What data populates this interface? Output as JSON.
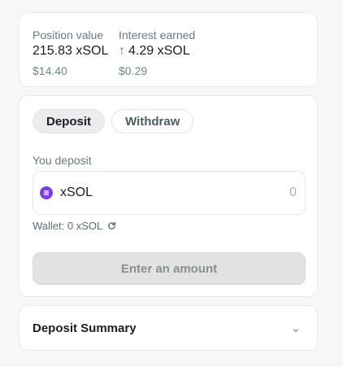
{
  "position": {
    "value_label": "Position value",
    "value_amount": "215.83 xSOL",
    "value_usd": "$14.40",
    "interest_label": "Interest earned",
    "interest_amount": "4.29 xSOL",
    "interest_usd": "$0.29",
    "interest_arrow": "↑"
  },
  "tabs": {
    "deposit": "Deposit",
    "withdraw": "Withdraw"
  },
  "deposit": {
    "label": "You deposit",
    "token": "xSOL",
    "token_icon": "xsol-token-icon",
    "amount_placeholder": "0",
    "wallet": "Wallet: 0 xSOL",
    "submit": "Enter an amount"
  },
  "summary": {
    "title": "Deposit Summary"
  },
  "colors": {
    "accent_up": "#22a447",
    "token": "#7b3fe4",
    "background": "#f6f7f8"
  }
}
